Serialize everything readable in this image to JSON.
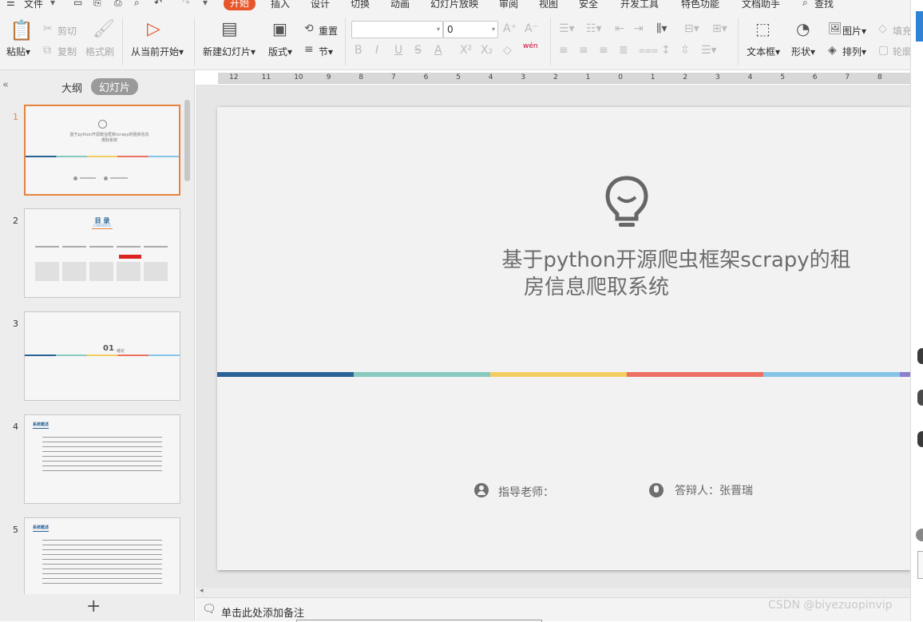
{
  "menu": {
    "file": "文件",
    "tabs": [
      "开始",
      "插入",
      "设计",
      "切换",
      "动画",
      "幻灯片放映",
      "审阅",
      "视图",
      "安全",
      "开发工具",
      "特色功能",
      "文档助手"
    ],
    "active_tab": "开始",
    "search": "查找"
  },
  "ribbon": {
    "paste": "粘贴",
    "cut": "剪切",
    "copy": "复制",
    "format_painter": "格式刷",
    "play_from_current": "从当前开始",
    "new_slide": "新建幻灯片",
    "layout": "版式",
    "reset": "重置",
    "section": "节",
    "font_name_value": "",
    "font_size_value": "0",
    "textbox": "文本框",
    "shape": "形状",
    "picture": "图片",
    "arrange": "排列",
    "fill": "填充",
    "outline": "轮廓",
    "font_buttons": [
      "B",
      "I",
      "U",
      "S",
      "A",
      "X²",
      "X₂"
    ],
    "pinyin_label": "wén"
  },
  "left_panel": {
    "tab_outline": "大纲",
    "tab_slides": "幻灯片",
    "add_slide": "+",
    "thumbnails": [
      {
        "num": "1",
        "title": "基于python开源爬虫框架scrapy的租房信息爬取系统"
      },
      {
        "num": "2",
        "title": "目 录",
        "subtitle": "CONTENTS"
      },
      {
        "num": "3",
        "title": "01",
        "subtitle": "绪论"
      },
      {
        "num": "4",
        "title": "系统概述"
      },
      {
        "num": "5",
        "title": "系统概述"
      }
    ]
  },
  "ruler": {
    "labels": [
      "12",
      "11",
      "10",
      "9",
      "8",
      "7",
      "6",
      "5",
      "4",
      "3",
      "2",
      "1",
      "0",
      "1",
      "2",
      "3",
      "4",
      "5",
      "6",
      "7",
      "8"
    ]
  },
  "slide": {
    "title_line1": "基于python开源爬虫框架scrapy的租",
    "title_line2": "房信息爬取系统",
    "advisor_label": "指导老师：",
    "presenter_label": "答辩人：张晋瑞",
    "stripe_colors": [
      "#2a6496",
      "#88c9c0",
      "#f4cd62",
      "#ec7163",
      "#86c4e8",
      "#8c7fcf"
    ]
  },
  "notes": {
    "placeholder": "单击此处添加备注"
  },
  "watermark": "CSDN @biyezuopinvip",
  "colors": {
    "accent": "#e8552b",
    "selection_border": "#e8823f"
  }
}
